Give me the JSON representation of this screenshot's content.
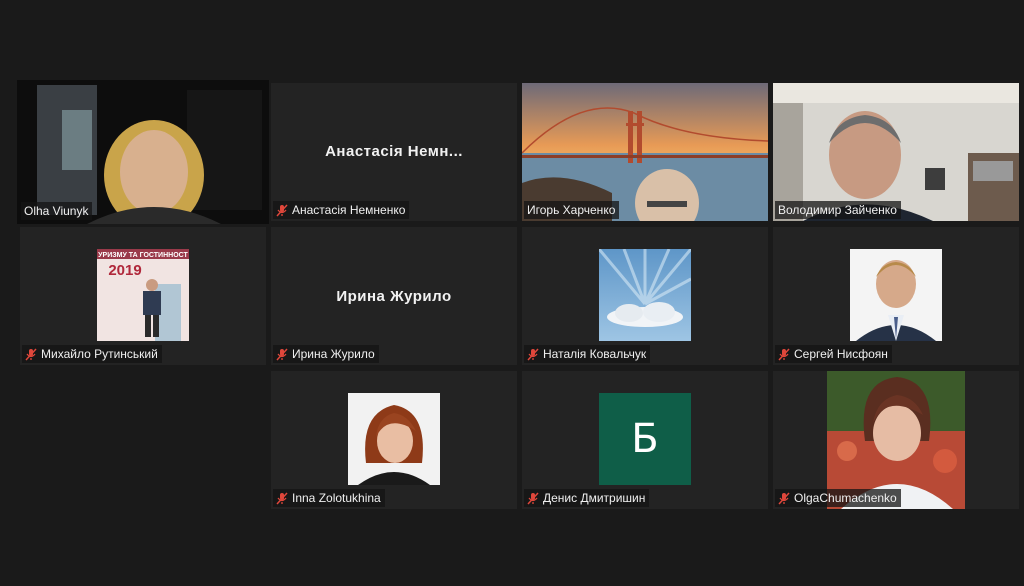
{
  "participants": [
    {
      "name": "Olha Viunyk",
      "muted": false
    },
    {
      "name": "Анастасія Немненко",
      "display_name": "Анастасія Немн...",
      "muted": true
    },
    {
      "name": "Игорь Харченко",
      "muted": false
    },
    {
      "name": "Володимир Зайченко",
      "muted": false
    },
    {
      "name": "Михайло Рутинський",
      "muted": true,
      "banner_text": "УРИЗМУ ТА ГОСТИННОСТ",
      "banner_year": "2019"
    },
    {
      "name": "Ирина Журило",
      "display_name": "Ирина Журило",
      "muted": true
    },
    {
      "name": "Наталія Ковальчук",
      "muted": true
    },
    {
      "name": "Сергей Нисфоян",
      "muted": true
    },
    {
      "name": "Inna Zolotukhina",
      "muted": true
    },
    {
      "name": "Денис Дмитришин",
      "muted": true,
      "avatar_letter": "Б"
    },
    {
      "name": "OlgaChumachenko",
      "muted": true
    }
  ],
  "colors": {
    "active_speaker_border": "#c9dd58",
    "muted_icon": "#e0473b",
    "letter_avatar_bg": "#0f5e48"
  }
}
